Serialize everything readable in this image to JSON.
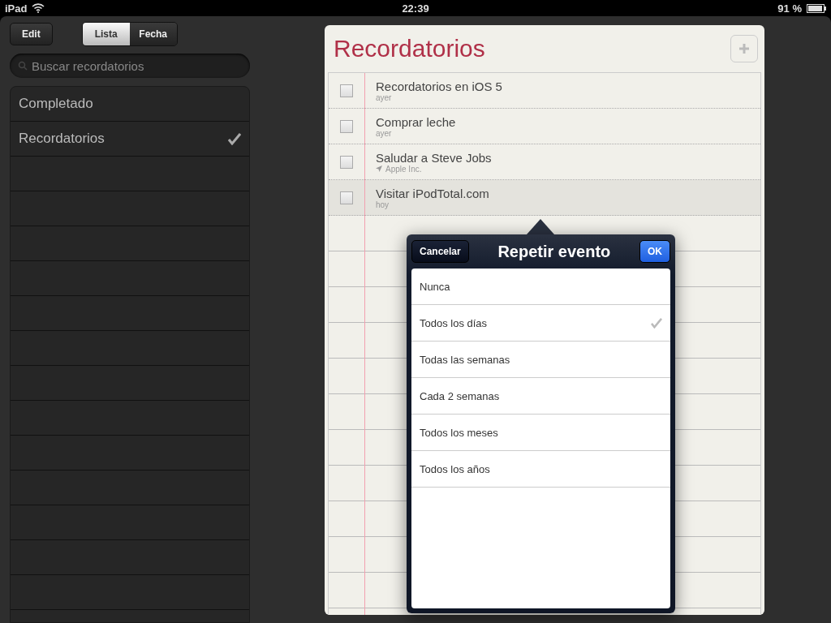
{
  "status_bar": {
    "device": "iPad",
    "time": "22:39",
    "battery": "91 %"
  },
  "toolbar": {
    "edit_button": "Edit",
    "segments": [
      {
        "label": "Lista",
        "selected": true
      },
      {
        "label": "Fecha",
        "selected": false
      }
    ]
  },
  "search": {
    "placeholder": "Buscar recordatorios"
  },
  "lists": [
    {
      "name": "Completado",
      "checked": false
    },
    {
      "name": "Recordatorios",
      "checked": true
    }
  ],
  "panel": {
    "title": "Recordatorios"
  },
  "reminders": [
    {
      "title": "Recordatorios en iOS 5",
      "kind": "date",
      "detail": "ayer",
      "checked": false,
      "selected": false
    },
    {
      "title": "Comprar leche",
      "kind": "date",
      "detail": "ayer",
      "checked": false,
      "selected": false
    },
    {
      "title": "Saludar a Steve Jobs",
      "kind": "location",
      "detail": "Apple Inc.",
      "checked": false,
      "selected": false
    },
    {
      "title": "Visitar iPodTotal.com",
      "kind": "date",
      "detail": "hoy",
      "checked": false,
      "selected": true
    }
  ],
  "popover": {
    "cancel_button": "Cancelar",
    "title": "Repetir evento",
    "ok_button": "OK",
    "options": [
      {
        "label": "Nunca",
        "checked": false
      },
      {
        "label": "Todos los días",
        "checked": true
      },
      {
        "label": "Todas las semanas",
        "checked": false
      },
      {
        "label": "Cada 2 semanas",
        "checked": false
      },
      {
        "label": "Todos los meses",
        "checked": false
      },
      {
        "label": "Todos los años",
        "checked": false
      }
    ]
  }
}
